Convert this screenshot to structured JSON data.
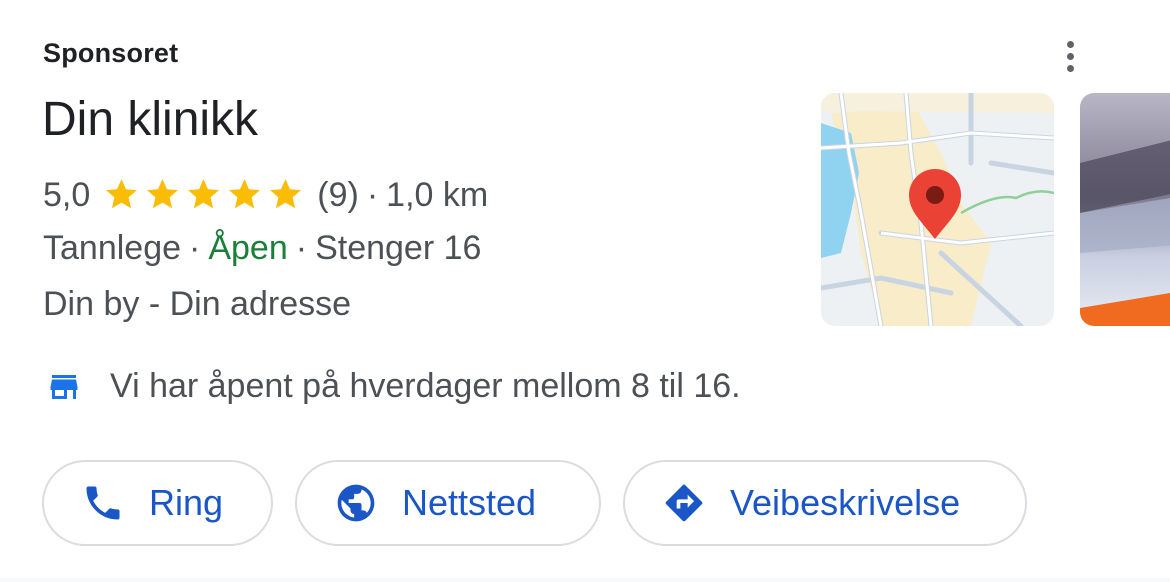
{
  "ad": {
    "sponsored_label": "Sponsoret",
    "title": "Din klinikk",
    "rating": {
      "score_text": "5,0",
      "stars": 5,
      "max_stars": 5,
      "review_count_text": "(9)",
      "separator": "·",
      "distance": "1,0 km"
    },
    "details": {
      "category": "Tannlege",
      "separator": "·",
      "open_status": "Åpen",
      "closing_text": "Stenger 16"
    },
    "address": "Din by - Din adresse",
    "notice": {
      "icon": "storefront-icon",
      "text": "Vi har åpent på hverdager mellom 8 til 16."
    },
    "actions": [
      {
        "label": "Ring",
        "icon": "phone-icon"
      },
      {
        "label": "Nettsted",
        "icon": "globe-icon"
      },
      {
        "label": "Veibeskrivelse",
        "icon": "directions-icon"
      }
    ],
    "colors": {
      "star": "#fbbc04",
      "open": "#188038",
      "action_blue": "#1a56c6",
      "map_pin": "#ea4335"
    }
  }
}
